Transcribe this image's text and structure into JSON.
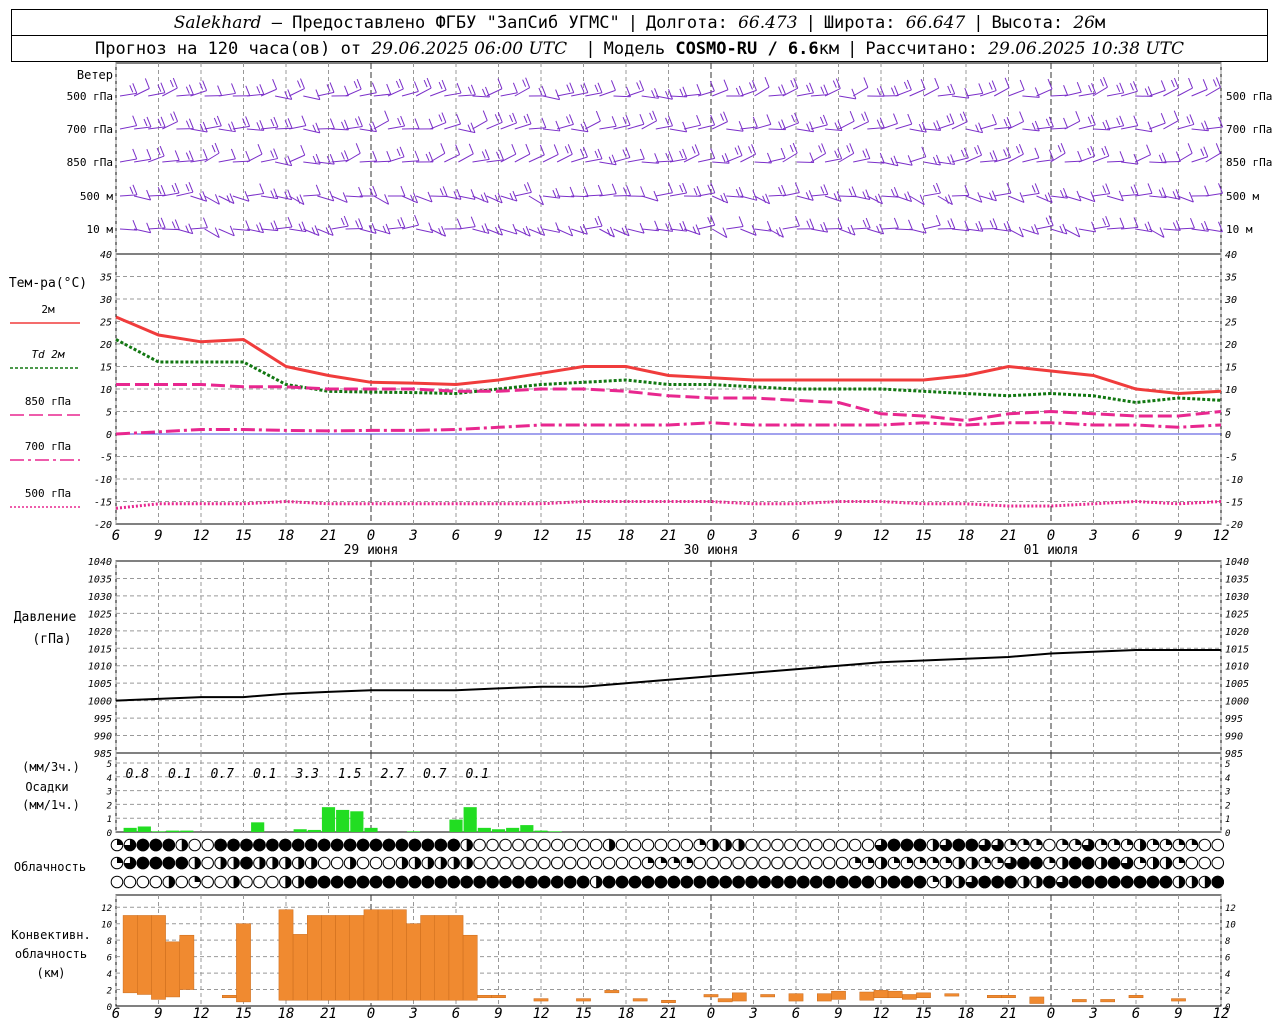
{
  "header": {
    "city": "Salekhard",
    "provider": "– Предоставлено ФГБУ \"ЗапСиб УГМС\"",
    "lon_label": "Долгота:",
    "lon": "66.473",
    "lat_label": "Широта:",
    "lat": "66.647",
    "alt_label": "Высота:",
    "alt": "26",
    "alt_unit": "м",
    "forecast_label": "Прогноз на 120 часа(ов) от",
    "forecast_from": "29.06.2025 06:00 UTC",
    "model_label": "Модель",
    "model": "COSMO-RU / 6.6",
    "model_unit": "км",
    "computed_label": "Рассчитано:",
    "computed": "29.06.2025 10:38 UTC"
  },
  "panels": {
    "wind": {
      "title": "Ветер",
      "levels": [
        "500 гПа",
        "700 гПа",
        "850 гПа",
        "500 м",
        "10  м"
      ]
    },
    "temperature": {
      "title": "Тем-ра(°C)",
      "legend": [
        {
          "label": "2м",
          "color": "#f03c3c",
          "dash": "solid"
        },
        {
          "label": "Td  2м",
          "color": "#117711",
          "dash": "dotted"
        },
        {
          "label": "850 гПа",
          "color": "#e8278f",
          "dash": "long-dash"
        },
        {
          "label": "700 гПа",
          "color": "#e8278f",
          "dash": "dash-dot"
        },
        {
          "label": "500 гПа",
          "color": "#e8278f",
          "dash": "fine-dot"
        }
      ]
    },
    "pressure": {
      "title": "Давление",
      "unit": "(гПа)"
    },
    "precip": {
      "unit3": "(мм/3ч.)",
      "title": "Осадки",
      "unit1": "(мм/1ч.)",
      "totals": [
        "0.8",
        "0.1",
        "0.7",
        "0.1",
        "3.3",
        "1.5",
        "2.7",
        "0.7",
        "0.1"
      ]
    },
    "cloud": {
      "title": "Облачность"
    },
    "convective": {
      "title1": "Конвективн.",
      "title2": "облачность",
      "unit": "(км)"
    }
  },
  "time_axis": {
    "hour_labels": [
      "6",
      "9",
      "12",
      "15",
      "18",
      "21",
      "0",
      "3",
      "6",
      "9",
      "12",
      "15",
      "18",
      "21",
      "0",
      "3",
      "6",
      "9",
      "12",
      "15",
      "18",
      "21",
      "0",
      "3",
      "6",
      "9",
      "12"
    ],
    "day_labels": [
      "29 июня",
      "30 июня",
      "01 июля"
    ]
  },
  "chart_data": [
    {
      "type": "line",
      "title": "Тем-ра(°C)",
      "x_hours_from_start": [
        0,
        3,
        6,
        9,
        12,
        15,
        18,
        21,
        24,
        27,
        30,
        33,
        36,
        39,
        42,
        45,
        48,
        51,
        54,
        57,
        60,
        63,
        66,
        69,
        72,
        75,
        78
      ],
      "ylim": [
        -20,
        40
      ],
      "series": [
        {
          "name": "2м",
          "values": [
            26,
            22,
            20.5,
            21,
            15,
            13,
            11.5,
            11.3,
            11,
            12,
            13.5,
            15,
            15,
            13,
            12.5,
            12,
            12,
            12,
            12,
            12,
            13,
            15,
            14,
            13,
            10,
            9,
            9.5
          ]
        },
        {
          "name": "Td  2м",
          "values": [
            21,
            16,
            16,
            16,
            11,
            9.5,
            9.3,
            9.2,
            9,
            10,
            11,
            11.5,
            12,
            11,
            11,
            10.5,
            10,
            10,
            10,
            9.5,
            9,
            8.5,
            9,
            8.5,
            7,
            8,
            7.5
          ]
        },
        {
          "name": "850 гПа",
          "values": [
            11,
            11,
            11,
            10.5,
            10.5,
            10,
            10,
            10,
            9.5,
            9.5,
            10,
            10,
            9.5,
            8.5,
            8,
            8,
            7.5,
            7,
            4.5,
            4,
            3,
            4.5,
            5,
            4.5,
            4,
            4,
            5
          ]
        },
        {
          "name": "700 гПа",
          "values": [
            0,
            0.5,
            1,
            1,
            0.8,
            0.7,
            0.8,
            0.8,
            1,
            1.5,
            2,
            2,
            2,
            2,
            2.5,
            2,
            2,
            2,
            2,
            2.5,
            2,
            2.5,
            2.5,
            2,
            2,
            1.5,
            2
          ]
        },
        {
          "name": "500 гПа",
          "values": [
            -16.5,
            -15.5,
            -15.5,
            -15.5,
            -15,
            -15.5,
            -15.5,
            -15.5,
            -15.5,
            -15.5,
            -15.5,
            -15,
            -15,
            -15,
            -15,
            -15.5,
            -15.5,
            -15,
            -15,
            -15.5,
            -15.5,
            -16,
            -16,
            -15.5,
            -15,
            -15.5,
            -15
          ]
        }
      ]
    },
    {
      "type": "line",
      "title": "Давление",
      "ylabel": "(гПа)",
      "x_hours_from_start": [
        0,
        3,
        6,
        9,
        12,
        15,
        18,
        21,
        24,
        27,
        30,
        33,
        36,
        39,
        42,
        45,
        48,
        51,
        54,
        57,
        60,
        63,
        66,
        69,
        72,
        75,
        78
      ],
      "ylim": [
        985,
        1040
      ],
      "series": [
        {
          "values": [
            1000,
            1000.5,
            1001,
            1001,
            1002,
            1002.5,
            1003,
            1003,
            1003,
            1003.5,
            1004,
            1004,
            1005,
            1006,
            1007,
            1008,
            1009,
            1010,
            1011,
            1011.5,
            1012,
            1012.5,
            1013.5,
            1014,
            1014.5,
            1014.5,
            1014.5
          ]
        }
      ]
    },
    {
      "type": "bar",
      "title": "Осадки",
      "ylabel": "(мм/1ч.)",
      "ylim": [
        0,
        5
      ],
      "x_hours_from_start": [
        1,
        2,
        3,
        4,
        5,
        6,
        7,
        8,
        9,
        10,
        11,
        12,
        13,
        14,
        15,
        16,
        17,
        18,
        19,
        20,
        21,
        22,
        23,
        24,
        25,
        26,
        27,
        28,
        29,
        30,
        31,
        32,
        33
      ],
      "values": [
        0.3,
        0.4,
        0.05,
        0.1,
        0.1,
        0,
        0,
        0,
        0,
        0.7,
        0,
        0,
        0.2,
        0.15,
        1.8,
        1.6,
        1.5,
        0.3,
        0,
        0,
        0.05,
        0,
        0,
        0.9,
        1.8,
        0.3,
        0.2,
        0.3,
        0.5,
        0.1,
        0.05,
        0,
        0
      ]
    },
    {
      "type": "bar",
      "title": "Конвективн. облачность",
      "ylabel": "(км)",
      "ylim": [
        0,
        13
      ],
      "bars": [
        {
          "x": 1,
          "bottom": 1.6,
          "top": 11
        },
        {
          "x": 2,
          "bottom": 1.4,
          "top": 11
        },
        {
          "x": 3,
          "bottom": 0.8,
          "top": 11
        },
        {
          "x": 4,
          "bottom": 1.1,
          "top": 7.8
        },
        {
          "x": 5,
          "bottom": 2.0,
          "top": 8.6
        },
        {
          "x": 8,
          "bottom": 1.0,
          "top": 1.3
        },
        {
          "x": 9,
          "bottom": 0.5,
          "top": 10
        },
        {
          "x": 12,
          "bottom": 0.7,
          "top": 11.7
        },
        {
          "x": 13,
          "bottom": 0.7,
          "top": 8.7
        },
        {
          "x": 14,
          "bottom": 0.7,
          "top": 11
        },
        {
          "x": 15,
          "bottom": 0.7,
          "top": 11
        },
        {
          "x": 16,
          "bottom": 0.7,
          "top": 11
        },
        {
          "x": 17,
          "bottom": 0.7,
          "top": 11
        },
        {
          "x": 18,
          "bottom": 0.7,
          "top": 11.7
        },
        {
          "x": 19,
          "bottom": 0.7,
          "top": 11.7
        },
        {
          "x": 20,
          "bottom": 0.7,
          "top": 11.7
        },
        {
          "x": 21,
          "bottom": 0.7,
          "top": 10
        },
        {
          "x": 22,
          "bottom": 0.7,
          "top": 11
        },
        {
          "x": 23,
          "bottom": 0.7,
          "top": 11
        },
        {
          "x": 24,
          "bottom": 0.7,
          "top": 11
        },
        {
          "x": 25,
          "bottom": 0.7,
          "top": 8.6
        },
        {
          "x": 26,
          "bottom": 1.0,
          "top": 1.3
        },
        {
          "x": 27,
          "bottom": 1.0,
          "top": 1.3
        },
        {
          "x": 30,
          "bottom": 0.6,
          "top": 0.9
        },
        {
          "x": 33,
          "bottom": 0.6,
          "top": 0.9
        },
        {
          "x": 35,
          "bottom": 1.6,
          "top": 1.9
        },
        {
          "x": 37,
          "bottom": 0.6,
          "top": 0.9
        },
        {
          "x": 39,
          "bottom": 0.4,
          "top": 0.7
        },
        {
          "x": 42,
          "bottom": 1.1,
          "top": 1.4
        },
        {
          "x": 43,
          "bottom": 0.5,
          "top": 0.9
        },
        {
          "x": 44,
          "bottom": 0.6,
          "top": 1.6
        },
        {
          "x": 46,
          "bottom": 1.1,
          "top": 1.4
        },
        {
          "x": 48,
          "bottom": 0.6,
          "top": 1.5
        },
        {
          "x": 50,
          "bottom": 0.6,
          "top": 1.5
        },
        {
          "x": 51,
          "bottom": 0.8,
          "top": 1.8
        },
        {
          "x": 53,
          "bottom": 0.7,
          "top": 1.7
        },
        {
          "x": 54,
          "bottom": 1.0,
          "top": 1.9
        },
        {
          "x": 55,
          "bottom": 1.0,
          "top": 1.8
        },
        {
          "x": 56,
          "bottom": 0.8,
          "top": 1.4
        },
        {
          "x": 57,
          "bottom": 1.0,
          "top": 1.6
        },
        {
          "x": 59,
          "bottom": 1.2,
          "top": 1.5
        },
        {
          "x": 62,
          "bottom": 1.0,
          "top": 1.3
        },
        {
          "x": 63,
          "bottom": 1.0,
          "top": 1.3
        },
        {
          "x": 65,
          "bottom": 0.3,
          "top": 1.1
        },
        {
          "x": 68,
          "bottom": 0.5,
          "top": 0.8
        },
        {
          "x": 70,
          "bottom": 0.5,
          "top": 0.8
        },
        {
          "x": 72,
          "bottom": 1.0,
          "top": 1.3
        },
        {
          "x": 75,
          "bottom": 0.6,
          "top": 0.9
        }
      ]
    }
  ],
  "cloud_cover": {
    "rows": [
      [
        1,
        3,
        4,
        4,
        4,
        2,
        0,
        0,
        4,
        4,
        4,
        4,
        4,
        4,
        4,
        4,
        4,
        4,
        4,
        4,
        4,
        4,
        4,
        4,
        4,
        4,
        4,
        2,
        0,
        0,
        0,
        0,
        0,
        0,
        0,
        0,
        0,
        0,
        2,
        0,
        0,
        0,
        0,
        0,
        0,
        1,
        2,
        2,
        2,
        0,
        0,
        0,
        0,
        0,
        0,
        0,
        0,
        0,
        0,
        3,
        4,
        4,
        4,
        2,
        3,
        4,
        4,
        3,
        3,
        1,
        1,
        1,
        0,
        1,
        1,
        3,
        1,
        1,
        1,
        2,
        1,
        1,
        1,
        1,
        0,
        0
      ],
      [
        1,
        3,
        4,
        4,
        4,
        4,
        2,
        0,
        2,
        2,
        4,
        2,
        2,
        2,
        2,
        2,
        0,
        0,
        2,
        0,
        0,
        0,
        2,
        2,
        2,
        2,
        2,
        2,
        0,
        0,
        0,
        0,
        0,
        0,
        0,
        0,
        0,
        0,
        0,
        0,
        0,
        1,
        1,
        1,
        1,
        0,
        0,
        0,
        0,
        0,
        0,
        0,
        0,
        0,
        0,
        0,
        0,
        1,
        1,
        2,
        1,
        1,
        1,
        1,
        1,
        2,
        2,
        1,
        1,
        3,
        4,
        4,
        1,
        2,
        4,
        4,
        2,
        4,
        3,
        1,
        2,
        2,
        1,
        0,
        0,
        0
      ],
      [
        0,
        0,
        0,
        0,
        2,
        0,
        1,
        0,
        0,
        2,
        0,
        0,
        0,
        2,
        2,
        4,
        4,
        4,
        4,
        4,
        4,
        4,
        4,
        4,
        4,
        4,
        4,
        4,
        4,
        4,
        4,
        4,
        4,
        4,
        4,
        4,
        4,
        2,
        4,
        4,
        4,
        4,
        4,
        4,
        4,
        4,
        4,
        4,
        4,
        4,
        4,
        4,
        4,
        4,
        4,
        4,
        4,
        4,
        4,
        2,
        4,
        4,
        4,
        1,
        2,
        2,
        3,
        4,
        4,
        4,
        2,
        2,
        4,
        3,
        4,
        4,
        4,
        4,
        4,
        4,
        4,
        4,
        2,
        2,
        2,
        4
      ]
    ]
  },
  "colors": {
    "wind": "#7b2fc9",
    "t2m": "#f03c3c",
    "td2m": "#117711",
    "levels": "#e8278f",
    "pressure": "#000000",
    "precip": "#22dd22",
    "convective": "#f08a30",
    "grid": "#999999",
    "zero_line": "#4444dd"
  }
}
